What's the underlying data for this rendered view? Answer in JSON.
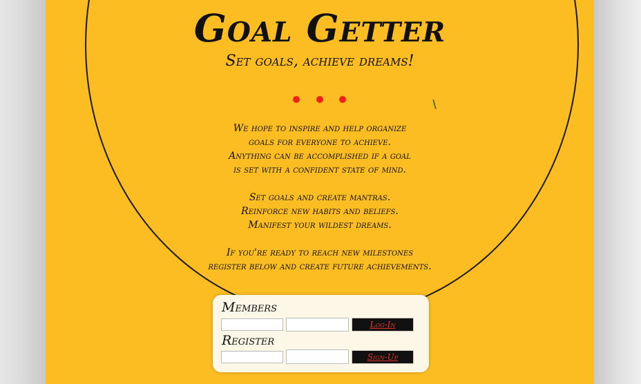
{
  "page": {
    "title": "Goal Getter",
    "subtitle": "Set goals, achieve dreams!",
    "accent_color": "#fcbd22",
    "dot_color": "#f2201a",
    "dots_count_shown": 3
  },
  "intro": {
    "paragraph1": [
      "We hope to inspire and help organize",
      "goals for everyone to achieve.",
      "Anything can be accomplished if a goal",
      "is set with a confident state of mind."
    ],
    "paragraph2": [
      "Set goals and create mantras.",
      "Reinforce new habits and beliefs.",
      "Manifest your wildest dreams."
    ],
    "paragraph3": [
      "If you're ready to reach new milestones",
      "register below and create future achievements."
    ]
  },
  "members": {
    "heading": "Members",
    "username_value": "",
    "password_value": "",
    "button_label": "Log-In"
  },
  "register": {
    "heading": "Register",
    "username_value": "",
    "password_value": "",
    "button_label": "Sign-Up"
  }
}
